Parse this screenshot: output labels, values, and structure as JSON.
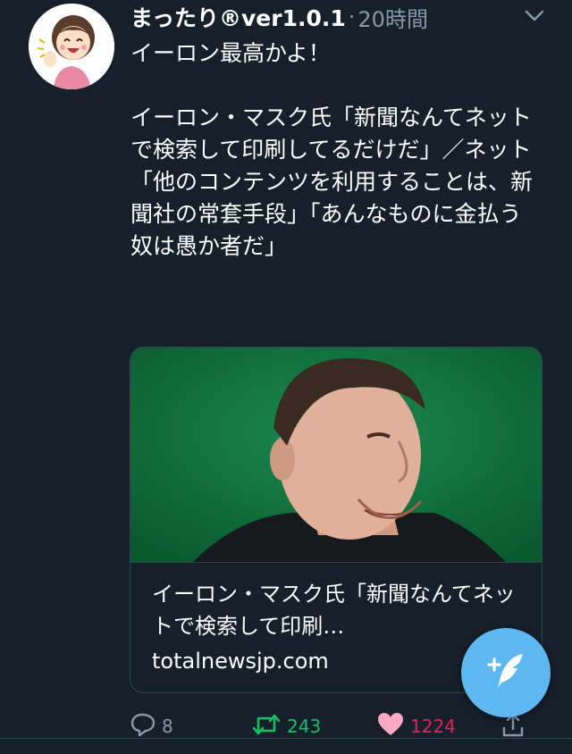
{
  "tweet": {
    "display_name": "まったり®ver1.0.1",
    "separator": "·",
    "time": "20時間",
    "text": "イーロン最高かよ！\n\nイーロン・マスク氏「新聞なんてネットで検索して印刷してるだけだ」／ネット「他のコンテンツを利用することは、新聞社の常套手段」「あんなものに金払う奴は愚か者だ」",
    "card": {
      "title": "イーロン・マスク氏「新聞なんてネットで検索して印刷…",
      "domain": "totalnewsjp.com"
    },
    "actions": {
      "reply_count": "8",
      "retweet_count": "243",
      "like_count": "1224"
    }
  },
  "icons": {
    "reply": "reply-icon",
    "retweet": "retweet-icon",
    "like": "heart-icon",
    "share": "share-icon",
    "menu": "chevron-down-icon",
    "compose": "compose-tweet-icon"
  },
  "colors": {
    "background": "#15202b",
    "secondary_text": "#8899a6",
    "retweet_green": "#17bf63",
    "like_pink": "#e0245e",
    "fab_blue": "#5fb7f0"
  }
}
